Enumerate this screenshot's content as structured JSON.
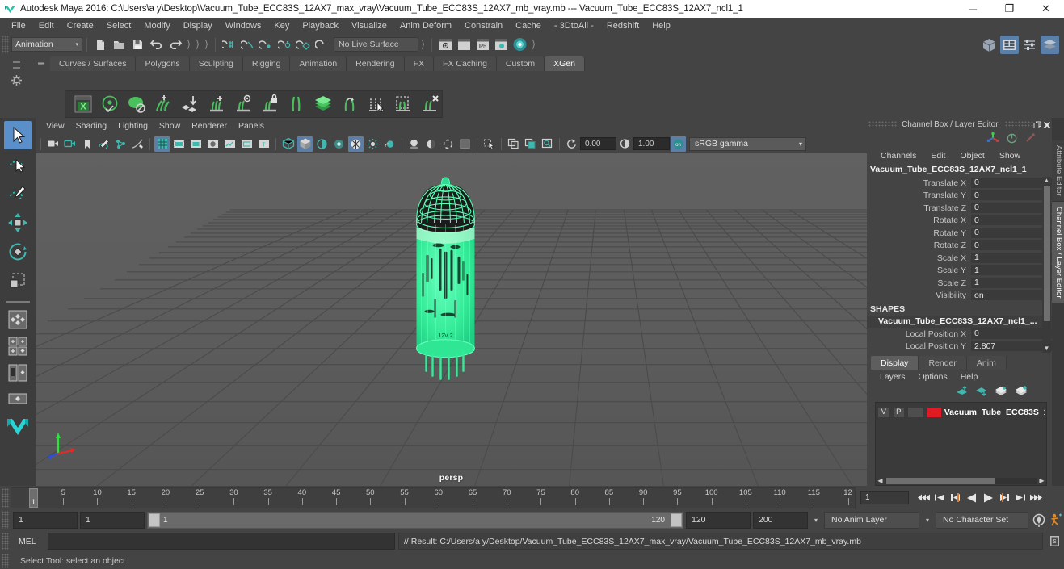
{
  "window": {
    "title": "Autodesk Maya 2016: C:\\Users\\a y\\Desktop\\Vacuum_Tube_ECC83S_12AX7_max_vray\\Vacuum_Tube_ECC83S_12AX7_mb_vray.mb  ---  Vacuum_Tube_ECC83S_12AX7_ncl1_1",
    "minimize": "─",
    "maximize": "❐",
    "close": "✕",
    "logo_icon": "maya-logo-icon"
  },
  "menubar": {
    "items": [
      "File",
      "Edit",
      "Create",
      "Select",
      "Modify",
      "Display",
      "Windows",
      "Key",
      "Playback",
      "Visualize",
      "Anim Deform",
      "Constrain",
      "Cache",
      "- 3DtoAll -",
      "Redshift",
      "Help"
    ]
  },
  "statusline": {
    "mode": "Animation",
    "mode_caret": "▾",
    "live_surface": "No Live Surface",
    "icons": [
      "new-scene-icon",
      "open-scene-icon",
      "save-scene-icon",
      "undo-icon",
      "redo-icon",
      "select-by-hierarchy-icon",
      "select-by-object-icon",
      "select-by-component-icon",
      "snap-to-grid-icon",
      "snap-to-curve-icon",
      "snap-to-point-icon",
      "snap-to-projected-center-icon",
      "snap-to-view-plane-icon",
      "make-live-icon"
    ],
    "right_icons": [
      "show-hide-modeling-toolkit-icon",
      "show-hide-attribute-editor-icon",
      "show-hide-tool-settings-icon",
      "show-hide-channel-box-icon"
    ]
  },
  "shelf": {
    "tabs": [
      "Curves / Surfaces",
      "Polygons",
      "Sculpting",
      "Rigging",
      "Animation",
      "Rendering",
      "FX",
      "FX Caching",
      "Custom",
      "XGen"
    ],
    "active_tab": "XGen",
    "handle_icon": "shelf-handle-icon",
    "buttons": [
      "xgen-editor-icon",
      "xgen-preview-icon",
      "xgen-disable-preview-icon",
      "xgen-add-collection-icon",
      "xgen-import-collection-icon",
      "xgen-create-description-icon",
      "xgen-preview-description-icon",
      "xgen-lock-description-icon",
      "xgen-guides-icon",
      "xgen-layers-icon",
      "xgen-convert-to-polygons-icon",
      "xgen-select-guides-icon",
      "xgen-region-tool-icon",
      "xgen-delete-guides-icon"
    ]
  },
  "toolbox": {
    "tools": [
      {
        "name": "select-tool",
        "selected": true
      },
      {
        "name": "lasso-select-tool",
        "selected": false
      },
      {
        "name": "paint-select-tool",
        "selected": false
      },
      {
        "name": "move-tool",
        "selected": false
      },
      {
        "name": "rotate-tool",
        "selected": false
      },
      {
        "name": "scale-tool",
        "selected": false
      }
    ],
    "layouts": [
      "single-perspective-layout-icon",
      "four-view-layout-icon",
      "two-pane-layout-icon",
      "outliner-persp-layout-icon",
      "persp-graph-layout-icon"
    ],
    "maya-logo": "maya-watermark-icon"
  },
  "viewport": {
    "menus": [
      "View",
      "Shading",
      "Lighting",
      "Show",
      "Renderer",
      "Panels"
    ],
    "camera_label": "persp",
    "exposure": "0.00",
    "gamma_value": "1.00",
    "color_management": "sRGB gamma",
    "gamma_caret": "▾",
    "toolbar_icons": [
      "select-camera-icon",
      "camera-attributes-icon",
      "bookmark-icon",
      "image-plane-icon",
      "two-d-pan-zoom-icon",
      "grease-pencil-icon",
      "grid-toggle-icon",
      "film-gate-icon",
      "resolution-gate-icon",
      "gate-mask-icon",
      "film-origin-icon",
      "safe-action-icon",
      "safe-title-icon",
      "wireframe-icon",
      "smooth-shade-all-icon",
      "smooth-shade-selected-icon",
      "flat-shade-icon",
      "wireframe-on-shaded-icon",
      "xray-icon",
      "xray-joints-icon",
      "use-default-light-icon",
      "use-all-lights-icon",
      "shadows-icon",
      "screen-space-ao-icon",
      "motion-blur-icon",
      "multisample-icon",
      "isolate-select-icon",
      "exposure-icon",
      "gamma-icon",
      "color-management-toggle-icon"
    ],
    "model_name": "Vacuum_Tube_ECC83S_12AX7_ncl1_1",
    "selection_color": "#3df3a0",
    "background_color": "#5b5b5b"
  },
  "channelbox": {
    "panel_title": "Channel Box / Layer Editor",
    "undock_icon": "undock-icon",
    "close_icon": "close-icon",
    "header_icons": [
      "manipulator-tool-icon",
      "no-operation-icon",
      "move-tool-disabled-icon"
    ],
    "menus": [
      "Channels",
      "Edit",
      "Object",
      "Show"
    ],
    "object_name": "Vacuum_Tube_ECC83S_12AX7_ncl1_1",
    "transform_rows": [
      {
        "label": "Translate X",
        "value": "0"
      },
      {
        "label": "Translate Y",
        "value": "0"
      },
      {
        "label": "Translate Z",
        "value": "0"
      },
      {
        "label": "Rotate X",
        "value": "0"
      },
      {
        "label": "Rotate Y",
        "value": "0"
      },
      {
        "label": "Rotate Z",
        "value": "0"
      },
      {
        "label": "Scale X",
        "value": "1"
      },
      {
        "label": "Scale Y",
        "value": "1"
      },
      {
        "label": "Scale Z",
        "value": "1"
      },
      {
        "label": "Visibility",
        "value": "on"
      }
    ],
    "shapes_header": "SHAPES",
    "shape_name": "Vacuum_Tube_ECC83S_12AX7_ncl1_...",
    "shape_rows": [
      {
        "label": "Local Position X",
        "value": "0"
      },
      {
        "label": "Local Position Y",
        "value": "2.807"
      }
    ],
    "scroll_up": "▲",
    "scroll_down": "▼"
  },
  "layereditor": {
    "tabs": [
      "Display",
      "Render",
      "Anim"
    ],
    "active_tab": "Display",
    "menus": [
      "Layers",
      "Options",
      "Help"
    ],
    "icon_buttons": [
      "move-layer-up-icon",
      "move-layer-down-icon",
      "create-empty-layer-icon",
      "create-layer-from-selected-icon"
    ],
    "layers": [
      {
        "visibility": "V",
        "playback": "P",
        "type": "",
        "color": "#e01b24",
        "name": "Vacuum_Tube_ECC83S_1"
      }
    ],
    "scroll_left": "◀",
    "scroll_right": "▶"
  },
  "timeline": {
    "ticks": [
      "5",
      "10",
      "15",
      "20",
      "25",
      "30",
      "35",
      "40",
      "45",
      "50",
      "55",
      "60",
      "65",
      "70",
      "75",
      "80",
      "85",
      "90",
      "95",
      "100",
      "105",
      "110",
      "115",
      "12"
    ],
    "current_frame": "1",
    "current_frame_field": "1",
    "playback_buttons": [
      "go-to-start-icon",
      "step-back-key-icon",
      "step-back-frame-icon",
      "play-backwards-icon",
      "play-forwards-icon",
      "step-forward-frame-icon",
      "step-forward-key-icon",
      "go-to-end-icon"
    ]
  },
  "rangeslider": {
    "anim_start": "1",
    "playback_start": "1",
    "slider_start_label": "1",
    "slider_end_label": "120",
    "playback_end": "120",
    "anim_end": "200",
    "anim_layer": "No Anim Layer",
    "character_set": "No Character Set",
    "dropdown_caret": "▾",
    "auto_key_icon": "auto-keyframe-icon",
    "anim_prefs_icon": "animation-preferences-icon"
  },
  "commandline": {
    "label": "MEL",
    "input_value": "",
    "result": "// Result: C:/Users/a y/Desktop/Vacuum_Tube_ECC83S_12AX7_max_vray/Vacuum_Tube_ECC83S_12AX7_mb_vray.mb",
    "script_editor_icon": "script-editor-icon"
  },
  "helpline": {
    "text": "Select Tool: select an object"
  },
  "side_tabs": {
    "items": [
      "Attribute Editor",
      "Channel Box / Layer Editor"
    ],
    "active": "Channel Box / Layer Editor"
  },
  "colors": {
    "bg": "#444444",
    "panel": "#3a3a3a",
    "accent_blue": "#5b7fa6",
    "accent_teal": "#3fb8b0",
    "selection_green": "#3df3a0",
    "layer_red": "#e01b24",
    "viewport_bg": "#5b5b5b"
  }
}
